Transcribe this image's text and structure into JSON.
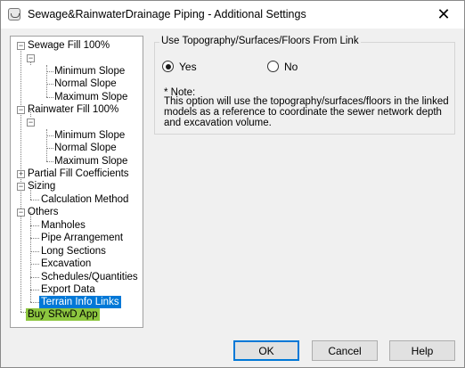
{
  "window": {
    "title": "Sewage&RainwaterDrainage Piping  - Additional Settings",
    "close_glyph": "✕"
  },
  "tree": {
    "sewage": {
      "label": "Sewage Fill 100%",
      "children": [
        "Minimum Slope",
        "Normal Slope",
        "Maximum Slope"
      ]
    },
    "rainwater": {
      "label": "Rainwater Fill 100%",
      "children": [
        "Minimum Slope",
        "Normal Slope",
        "Maximum Slope"
      ]
    },
    "partial": {
      "label": "Partial Fill Coefficients"
    },
    "sizing": {
      "label": "Sizing",
      "children": [
        "Calculation Method"
      ]
    },
    "others": {
      "label": "Others",
      "children": [
        "Manholes",
        "Pipe Arrangement",
        "Long Sections",
        "Excavation",
        "Schedules/Quantities",
        "Export Data",
        "Terrain Info Links"
      ]
    },
    "buy": {
      "label": "Buy SRwD App"
    }
  },
  "group": {
    "title": "Use Topography/Surfaces/Floors From Link",
    "yes_label": "Yes",
    "no_label": "No",
    "selected": "Yes",
    "note_title": "*  Note:",
    "note_text": "This option will use the topography/surfaces/floors in the linked models as a reference to coordinate the sewer network depth and excavation volume."
  },
  "buttons": {
    "ok": "OK",
    "cancel": "Cancel",
    "help": "Help"
  },
  "colors": {
    "selection": "#0078d7",
    "highlight": "#8dc63f"
  },
  "icons": {
    "app": "sewer-app-icon",
    "close": "close-icon",
    "collapse": "minus-box-icon",
    "expand": "plus-box-icon"
  }
}
